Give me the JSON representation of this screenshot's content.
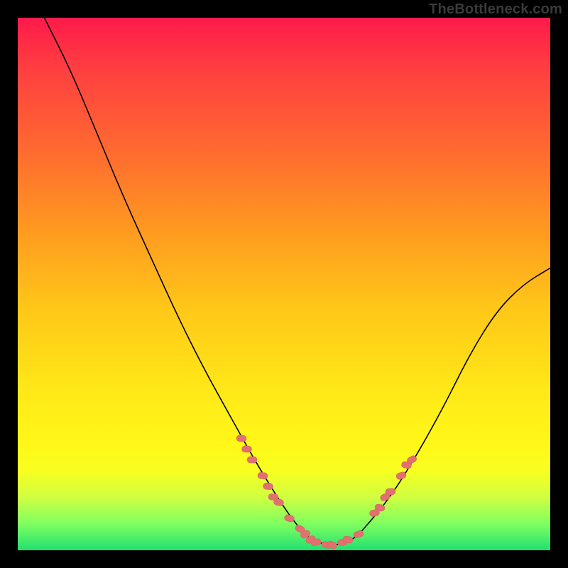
{
  "watermark": "TheBottleneck.com",
  "chart_data": {
    "type": "line",
    "title": "",
    "xlabel": "",
    "ylabel": "",
    "xlim": [
      0,
      100
    ],
    "ylim": [
      0,
      100
    ],
    "grid": false,
    "legend": false,
    "background_gradient": {
      "top": "#ff1a4a",
      "bottom": "#20e070"
    },
    "series": [
      {
        "name": "bottleneck-curve",
        "x": [
          5,
          10,
          15,
          20,
          25,
          30,
          35,
          40,
          45,
          50,
          53,
          55,
          58,
          60,
          63,
          65,
          70,
          75,
          80,
          85,
          90,
          95,
          100
        ],
        "y": [
          100,
          90,
          78,
          66,
          55,
          44,
          34,
          25,
          16,
          8,
          4,
          2,
          1,
          1,
          2,
          4,
          10,
          18,
          27,
          37,
          45,
          50,
          53
        ]
      }
    ],
    "highlight_clusters": [
      {
        "name": "left-cluster",
        "points": [
          {
            "x": 42,
            "y": 21
          },
          {
            "x": 43,
            "y": 19
          },
          {
            "x": 44,
            "y": 17
          },
          {
            "x": 46,
            "y": 14
          },
          {
            "x": 47,
            "y": 12
          },
          {
            "x": 48,
            "y": 10
          },
          {
            "x": 49,
            "y": 9
          },
          {
            "x": 51,
            "y": 6
          },
          {
            "x": 53,
            "y": 4
          },
          {
            "x": 54,
            "y": 3
          }
        ]
      },
      {
        "name": "bottom-cluster",
        "points": [
          {
            "x": 55,
            "y": 2
          },
          {
            "x": 56,
            "y": 1.5
          },
          {
            "x": 58,
            "y": 1
          },
          {
            "x": 59,
            "y": 1
          },
          {
            "x": 61,
            "y": 1.5
          },
          {
            "x": 62,
            "y": 2
          },
          {
            "x": 64,
            "y": 3
          }
        ]
      },
      {
        "name": "right-cluster",
        "points": [
          {
            "x": 67,
            "y": 7
          },
          {
            "x": 68,
            "y": 8
          },
          {
            "x": 69,
            "y": 10
          },
          {
            "x": 70,
            "y": 11
          },
          {
            "x": 72,
            "y": 14
          },
          {
            "x": 73,
            "y": 16
          },
          {
            "x": 74,
            "y": 17
          }
        ]
      }
    ]
  }
}
